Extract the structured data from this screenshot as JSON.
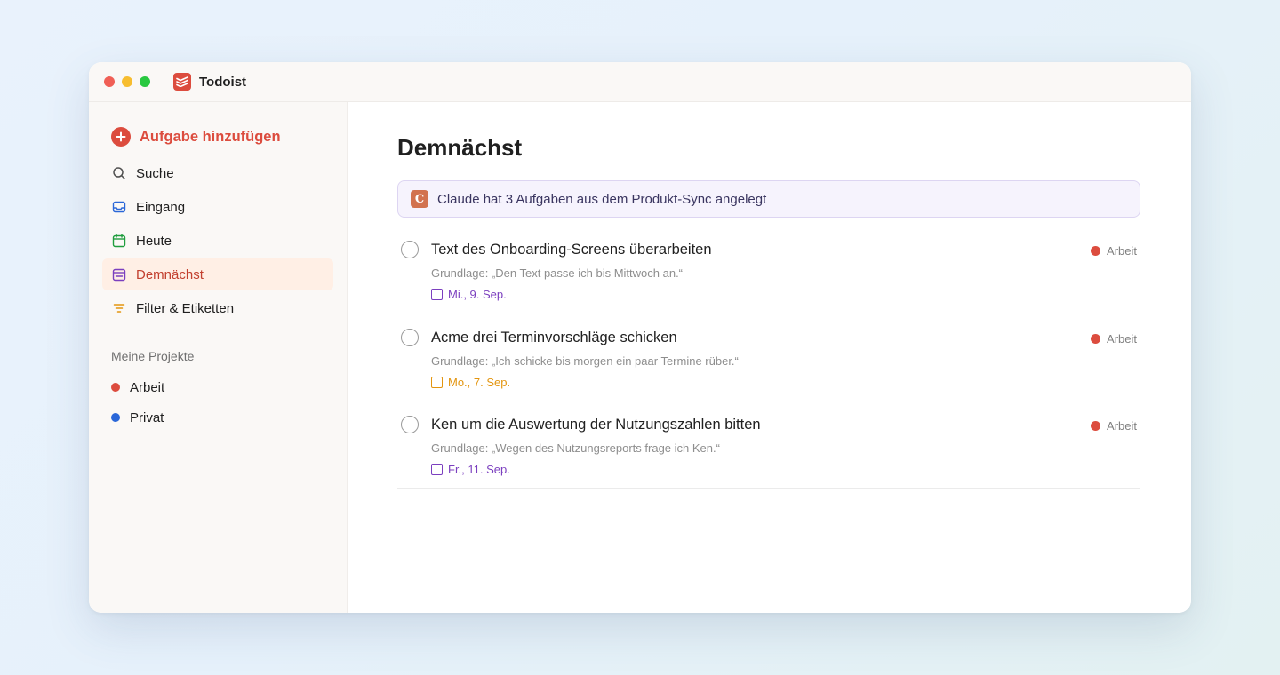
{
  "app": {
    "title": "Todoist"
  },
  "sidebar": {
    "add_task_label": "Aufgabe hinzufügen",
    "items": [
      {
        "label": "Suche",
        "icon": "search-icon"
      },
      {
        "label": "Eingang",
        "icon": "inbox-icon"
      },
      {
        "label": "Heute",
        "icon": "calendar-today-icon"
      },
      {
        "label": "Demnächst",
        "icon": "calendar-upcoming-icon",
        "active": true
      },
      {
        "label": "Filter & Etiketten",
        "icon": "filter-icon"
      }
    ],
    "projects_heading": "Meine Projekte",
    "projects": [
      {
        "label": "Arbeit",
        "color": "#dc4c3e"
      },
      {
        "label": "Privat",
        "color": "#2a67d8"
      }
    ]
  },
  "main": {
    "title": "Demnächst",
    "banner": {
      "badge": "C",
      "text": "Claude hat 3 Aufgaben aus dem Produkt-Sync angelegt"
    },
    "tasks": [
      {
        "title": "Text des Onboarding-Screens überarbeiten",
        "source": "Grundlage: „Den Text passe ich bis Mittwoch an.“",
        "date": "Mi., 9. Sep.",
        "date_color": "#7b3fbf",
        "project": "Arbeit",
        "project_color": "#dc4c3e"
      },
      {
        "title": "Acme drei Terminvorschläge schicken",
        "source": "Grundlage: „Ich schicke bis morgen ein paar Termine rüber.“",
        "date": "Mo., 7. Sep.",
        "date_color": "#e3950f",
        "project": "Arbeit",
        "project_color": "#dc4c3e"
      },
      {
        "title": "Ken um die Auswertung der Nutzungszahlen bitten",
        "source": "Grundlage: „Wegen des Nutzungsreports frage ich Ken.“",
        "date": "Fr., 11. Sep.",
        "date_color": "#7b3fbf",
        "project": "Arbeit",
        "project_color": "#dc4c3e"
      }
    ]
  }
}
